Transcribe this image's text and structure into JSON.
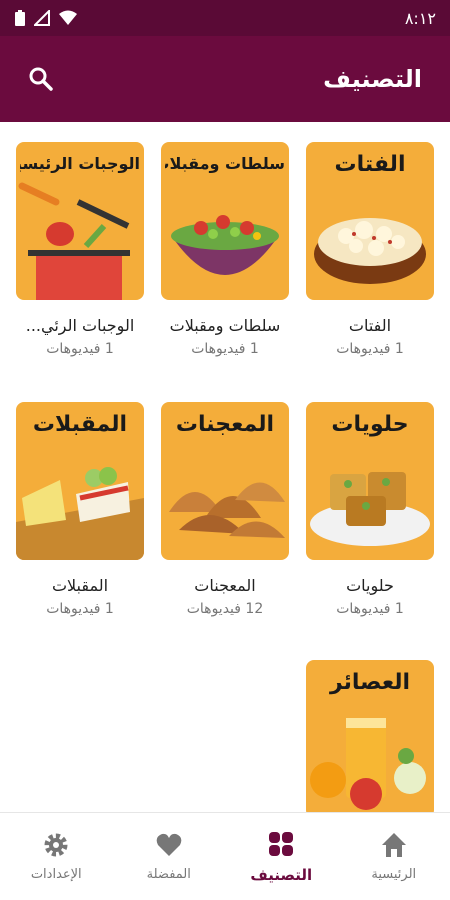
{
  "status_bar": {
    "time": "٨:١٢"
  },
  "app_bar": {
    "title": "التصنيف",
    "search_icon": "search-icon"
  },
  "categories": [
    {
      "thumb_title": "الفتات",
      "name": "الفتات",
      "count": "1 فيديوهات"
    },
    {
      "thumb_title": "سلطات ومقبلات",
      "name": "سلطات ومقبلات",
      "count": "1 فيديوهات"
    },
    {
      "thumb_title": "الوجبات الرئيسية",
      "name": "الوجبات الرئي...",
      "count": "1 فيديوهات"
    },
    {
      "thumb_title": "حلويات",
      "name": "حلويات",
      "count": "1 فيديوهات"
    },
    {
      "thumb_title": "المعجنات",
      "name": "المعجنات",
      "count": "12 فيديوهات"
    },
    {
      "thumb_title": "المقبلات",
      "name": "المقبلات",
      "count": "1 فيديوهات"
    },
    {
      "thumb_title": "العصائر",
      "name": "",
      "count": ""
    }
  ],
  "bottom_nav": [
    {
      "label": "الرئيسية",
      "icon": "home-icon",
      "active": false
    },
    {
      "label": "التصنيف",
      "icon": "grid-icon",
      "active": true
    },
    {
      "label": "المفضلة",
      "icon": "heart-icon",
      "active": false
    },
    {
      "label": "الإعدادات",
      "icon": "gear-icon",
      "active": false
    }
  ],
  "colors": {
    "primary": "#6b0b3e",
    "status": "#5a0a36",
    "tile": "#f4ad3a"
  }
}
